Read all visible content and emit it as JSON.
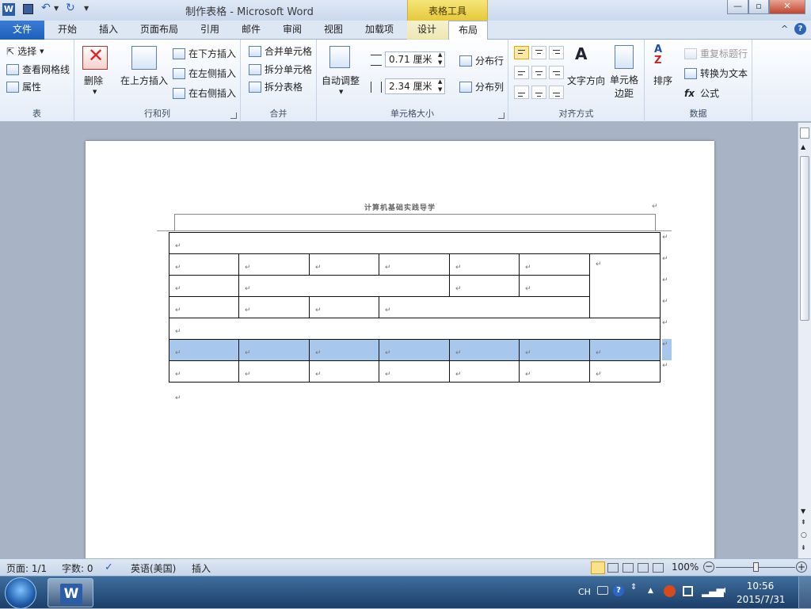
{
  "window": {
    "title": "制作表格 - Microsoft Word",
    "context_group": "表格工具",
    "btn_min": "—",
    "btn_max": "▫",
    "btn_close": "✕"
  },
  "tabs": {
    "file": "文件",
    "home": "开始",
    "insert": "插入",
    "page_layout": "页面布局",
    "references": "引用",
    "mailings": "邮件",
    "review": "审阅",
    "view": "视图",
    "addins": "加载项",
    "design": "设计",
    "layout": "布局"
  },
  "ribbon": {
    "table": {
      "select": "选择",
      "gridlines": "查看网格线",
      "properties": "属性",
      "label": "表"
    },
    "rows_cols": {
      "delete": "删除",
      "insert_above": "在上方插入",
      "insert_below": "在下方插入",
      "insert_left": "在左侧插入",
      "insert_right": "在右侧插入",
      "label": "行和列"
    },
    "merge": {
      "merge_cells": "合并单元格",
      "split_cells": "拆分单元格",
      "split_table": "拆分表格",
      "label": "合并"
    },
    "cell_size": {
      "autofit": "自动调整",
      "height": "0.71 厘米",
      "width": "2.34 厘米",
      "distribute_rows": "分布行",
      "distribute_cols": "分布列",
      "label": "单元格大小"
    },
    "alignment": {
      "text_direction": "文字方向",
      "cell_margins": "单元格\n边距",
      "label": "对齐方式"
    },
    "data": {
      "sort": "排序",
      "repeat_header": "重复标题行",
      "convert_text": "转换为文本",
      "formula": "公式",
      "label": "数据"
    }
  },
  "document": {
    "header": "计算机基础实践导学",
    "para_mark": "↵"
  },
  "status": {
    "page": "页面: 1/1",
    "words": "字数: 0",
    "language": "英语(美国)",
    "mode": "插入",
    "zoom": "100%"
  },
  "taskbar": {
    "lang": "CH",
    "time": "10:56",
    "date": "2015/7/31"
  }
}
